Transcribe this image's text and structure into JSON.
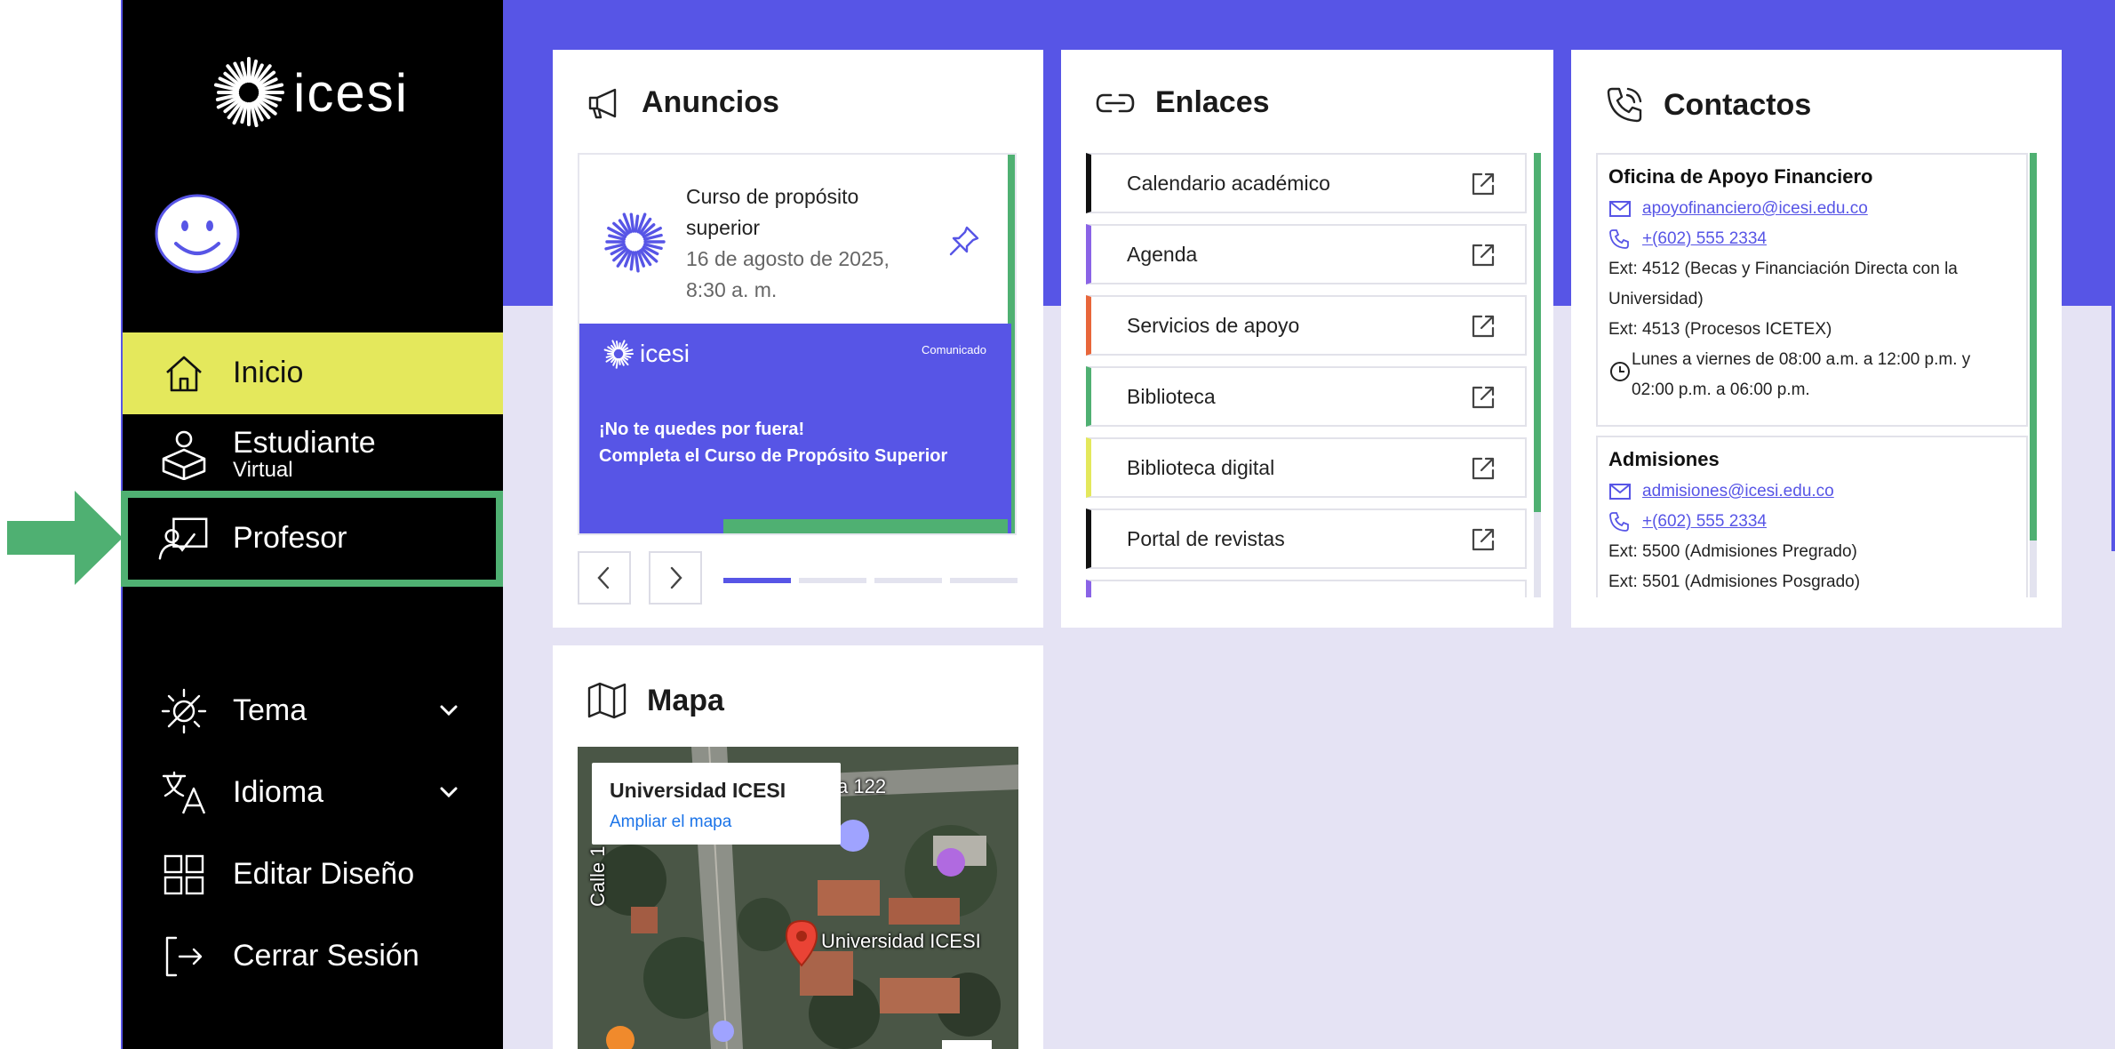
{
  "brand": {
    "name": "ICESI"
  },
  "sidebar": {
    "items": [
      {
        "label": "Inicio"
      },
      {
        "label": "Estudiante",
        "sub": "Virtual"
      },
      {
        "label": "Profesor"
      },
      {
        "label": "Tema"
      },
      {
        "label": "Idioma"
      },
      {
        "label": "Editar Diseño"
      },
      {
        "label": "Cerrar Sesión"
      }
    ]
  },
  "anuncios": {
    "title": "Anuncios",
    "item": {
      "title": "Curso de propósito superior",
      "date": "16 de agosto de 2025, 8:30 a. m."
    },
    "banner": {
      "brand": "ICESI",
      "tag": "Comunicado",
      "line1": "¡No te quedes por fuera!",
      "line2": "Completa el Curso de Propósito Superior"
    },
    "carousel": {
      "slides": 4,
      "active": 1
    }
  },
  "enlaces": {
    "title": "Enlaces",
    "items": [
      {
        "label": "Calendario académico",
        "color": "#111111"
      },
      {
        "label": "Agenda",
        "color": "#8a63e6"
      },
      {
        "label": "Servicios de apoyo",
        "color": "#e8663a"
      },
      {
        "label": "Biblioteca",
        "color": "#4fb072"
      },
      {
        "label": "Biblioteca digital",
        "color": "#e4e85c"
      },
      {
        "label": "Portal de revistas",
        "color": "#111111"
      }
    ]
  },
  "contactos": {
    "title": "Contactos",
    "items": [
      {
        "name": "Oficina de Apoyo Financiero",
        "email": "apoyofinanciero@icesi.edu.co",
        "phone": "+(602) 555 2334",
        "ext1": "Ext: 4512 (Becas y Financiación Directa con la Universidad)",
        "ext2": "Ext: 4513 (Procesos ICETEX)",
        "hours": "Lunes a viernes de 08:00 a.m. a 12:00 p.m. y 02:00 p.m. a 06:00 p.m."
      },
      {
        "name": "Admisiones",
        "email": "admisiones@icesi.edu.co",
        "phone": "+(602) 555 2334",
        "ext1": "Ext: 5500 (Admisiones Pregrado)",
        "ext2": "Ext: 5501 (Admisiones Posgrado)"
      }
    ]
  },
  "mapa": {
    "title": "Mapa",
    "place": "Universidad ICESI",
    "link": "Ampliar el mapa",
    "street1": "Calle 1",
    "street2": "a 122",
    "pin_label": "Universidad ICESI"
  },
  "colors": {
    "brand": "#5755e6",
    "highlight": "#e4e85c",
    "accent": "#4fb072"
  }
}
